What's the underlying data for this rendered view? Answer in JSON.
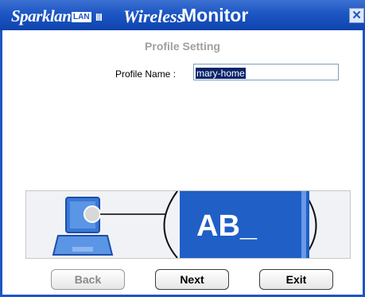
{
  "window": {
    "brand": "Sparklan",
    "brand_badge": "LAN",
    "brand_bars": "III",
    "title_italic": "Wireless",
    "title_bold": "Monitor",
    "close_glyph": "✕"
  },
  "page": {
    "section_title": "Profile Setting",
    "profile_name_label": "Profile Name :",
    "profile_name_value": "mary-home"
  },
  "illustration": {
    "screen_text": "AB_",
    "icons": [
      "laptop-icon"
    ]
  },
  "buttons": {
    "back_label": "Back",
    "next_label": "Next",
    "exit_label": "Exit"
  },
  "colors": {
    "titlebar": "#1c56c4",
    "accent": "#1f5fc6",
    "selection": "#0a246a"
  }
}
